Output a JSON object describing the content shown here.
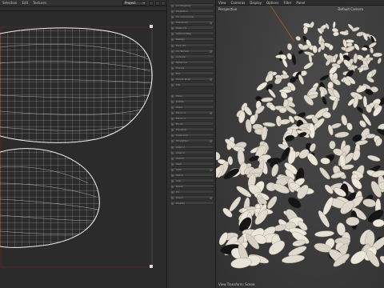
{
  "uv_editor": {
    "menu": [
      "Selection",
      "Edit",
      "Textures"
    ],
    "project_label": "Project"
  },
  "tool_panel": {
    "items": [
      "UV Mapping",
      "Projection",
      "UV Commands",
      "Transform",
      "Relax UV",
      "Optimal Map",
      "Realign",
      "Pack UV",
      "UV Terrace",
      "Cylinder",
      "Spherical",
      "Frontal",
      "Box",
      "Shrink Wrap",
      "Tile",
      "Move",
      "Rotate",
      "Scale",
      "Mirror U",
      "Mirror V",
      "Fit UV",
      "Equalize",
      "Snap Grid",
      "Straighten",
      "Align U",
      "Align V",
      "Unfold",
      "Weld",
      "Split",
      "Stitch",
      "Sew",
      "Break",
      "Pin",
      "Unpin",
      "Display"
    ]
  },
  "viewport": {
    "menu": [
      "View",
      "Cameras",
      "Display",
      "Options",
      "Filter",
      "Panel"
    ],
    "view_label": "Perspective",
    "camera_label": "Default Camera",
    "footer_label": "View Transform: Scene"
  }
}
